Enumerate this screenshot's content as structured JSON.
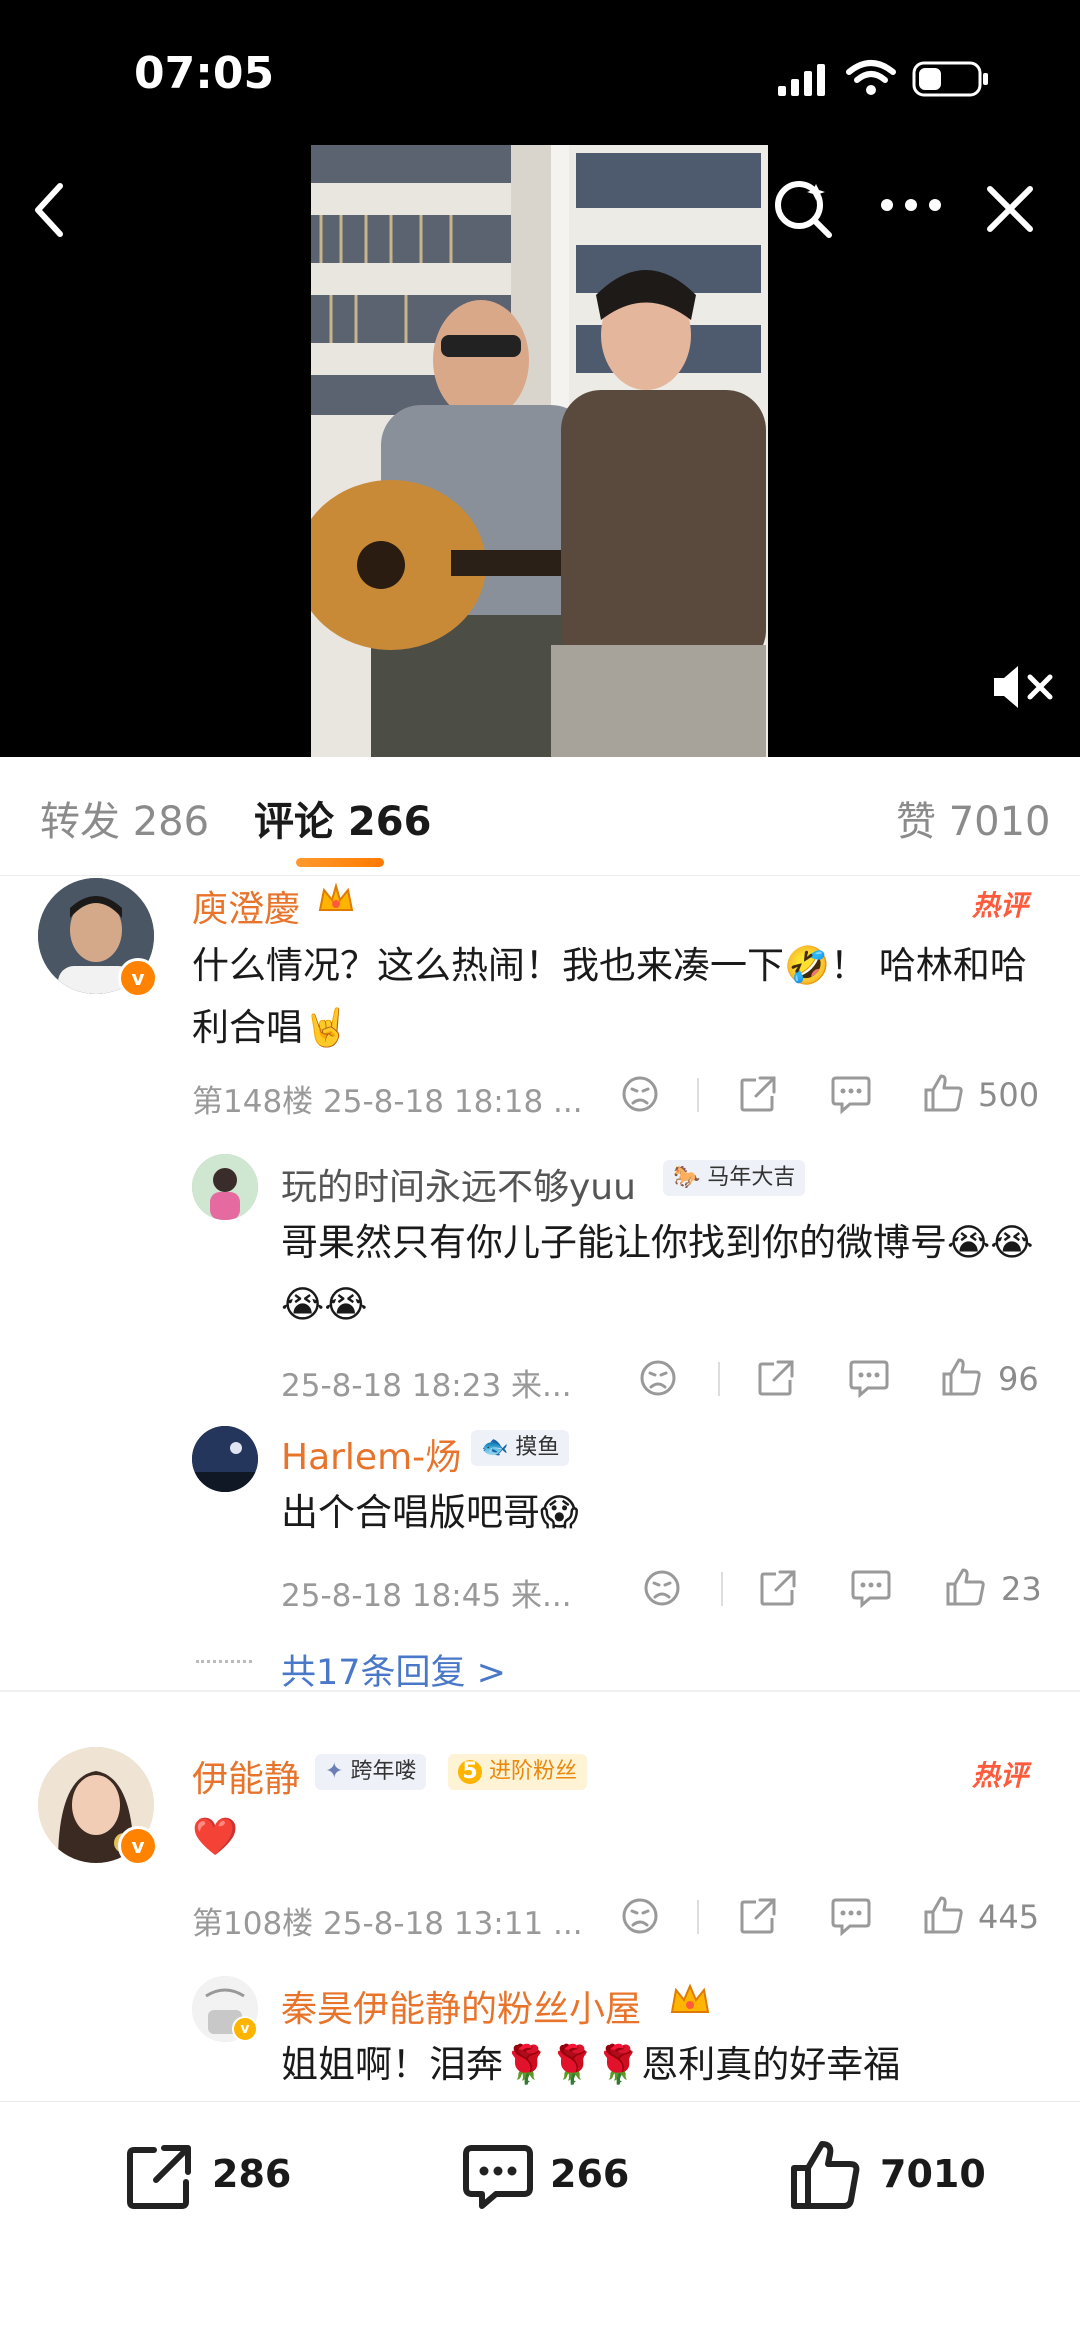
{
  "status_bar": {
    "time": "07:05"
  },
  "tabs": {
    "repost": "转发 286",
    "comments": "评论 266",
    "likes": "赞 7010"
  },
  "comments": [
    {
      "username": "庾澄慶",
      "hot_label": "热评",
      "text": "什么情况？这么热闹！我也来凑一下🤣！ 哈林和哈利合唱🤘",
      "meta": "第148楼 25-8-18 18:18 ...",
      "likes": "500",
      "replies": [
        {
          "username": "玩的时间永远不够yuu",
          "badge": "马年大吉",
          "text": "哥果然只有你儿子能让你找到你的微博号😭😭😭😭",
          "meta": "25-8-18 18:23 来...",
          "likes": "96"
        },
        {
          "username": "Harlem-炀",
          "badge": "摸鱼",
          "text": "出个合唱版吧哥😱",
          "meta": "25-8-18 18:45 来...",
          "likes": "23"
        }
      ],
      "more_replies": "共17条回复 >"
    },
    {
      "username": "伊能静",
      "badge_year": "跨年喽",
      "badge_fan_level": "5",
      "badge_fan": "进阶粉丝",
      "hot_label": "热评",
      "text": "❤️",
      "meta": "第108楼 25-8-18 13:11 ...",
      "likes": "445",
      "replies": [
        {
          "username": "秦昊伊能静的粉丝小屋",
          "text": "姐姐啊！泪奔🌹🌹🌹恩利真的好幸福"
        }
      ]
    }
  ],
  "bottom_bar": {
    "repost_count": "286",
    "comment_count": "266",
    "like_count": "7010"
  },
  "colors": {
    "accent": "#ff8200",
    "username": "#e8742c",
    "hot": "#ff5a3c"
  }
}
